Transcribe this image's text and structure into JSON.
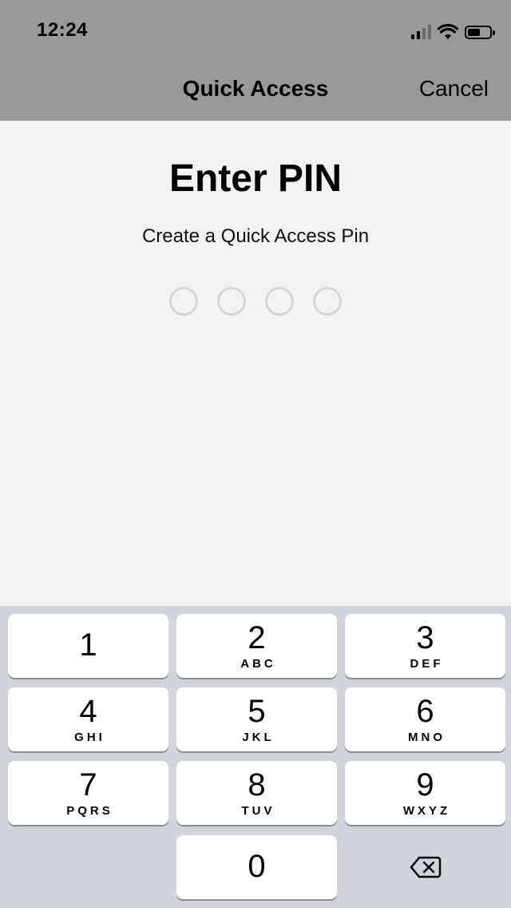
{
  "status_bar": {
    "time": "12:24"
  },
  "nav": {
    "title": "Quick Access",
    "cancel_label": "Cancel"
  },
  "pin": {
    "title": "Enter PIN",
    "subtitle": "Create a Quick Access Pin",
    "length": 4,
    "entered": 0
  },
  "keypad": {
    "keys": [
      {
        "digit": "1",
        "letters": ""
      },
      {
        "digit": "2",
        "letters": "ABC"
      },
      {
        "digit": "3",
        "letters": "DEF"
      },
      {
        "digit": "4",
        "letters": "GHI"
      },
      {
        "digit": "5",
        "letters": "JKL"
      },
      {
        "digit": "6",
        "letters": "MNO"
      },
      {
        "digit": "7",
        "letters": "PQRS"
      },
      {
        "digit": "8",
        "letters": "TUV"
      },
      {
        "digit": "9",
        "letters": "WXYZ"
      },
      {
        "digit": "0",
        "letters": ""
      }
    ],
    "delete_icon": "backspace-icon"
  },
  "colors": {
    "header_bg": "#999999",
    "content_bg": "#f2f2f2",
    "keypad_bg": "#d1d4da",
    "key_bg": "#ffffff",
    "pin_dot_border": "#d4d4d4"
  }
}
